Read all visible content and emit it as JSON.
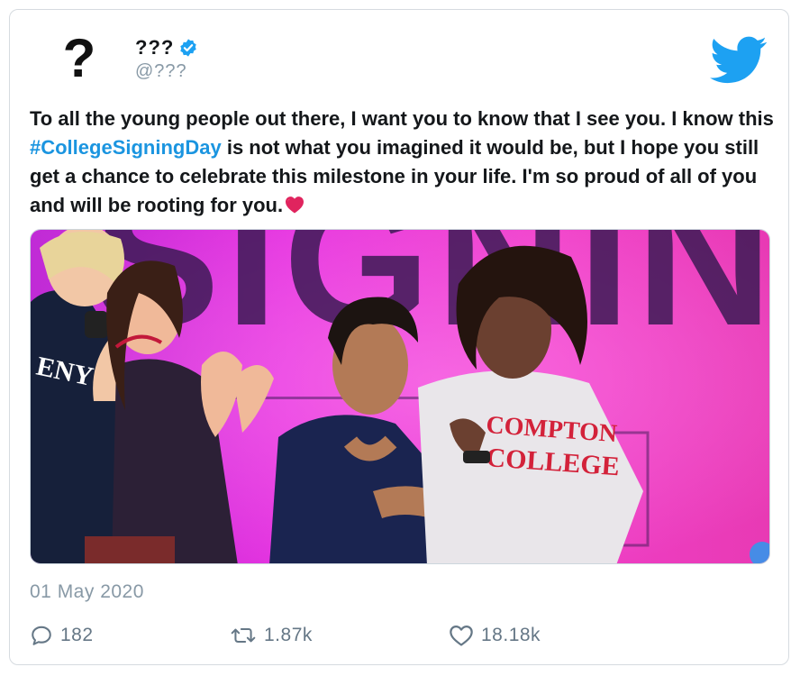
{
  "user": {
    "avatar_glyph": "?",
    "display_name": "???",
    "handle": "@???",
    "verified": true,
    "avatar_icon": "question-mark-icon"
  },
  "brand": {
    "logo_icon": "twitter-bird-icon",
    "accent_color": "#1da1f2"
  },
  "tweet": {
    "text_part1": "To all the young people out there, I want you to know that I see you. I know this ",
    "hashtag": "#CollegeSigningDay",
    "text_part2": " is not what you imagined it would be, but I hope you still get a chance to celebrate this milestone in your life. I'm so proud of all of you and will be rooting for you.",
    "emoji_icon": "red-heart-icon",
    "media_image": {
      "sign_text": "SIGNINGD",
      "sweatshirt_line1": "COMPTON",
      "sweatshirt_line2": "COLLEGE"
    },
    "timestamp": "01 May 2020"
  },
  "actions": {
    "replies": "182",
    "retweets": "1.87k",
    "likes": "18.18k"
  },
  "colors": {
    "hashtag": "#1b95e0",
    "text": "#14171a",
    "muted": "#8899a6"
  }
}
